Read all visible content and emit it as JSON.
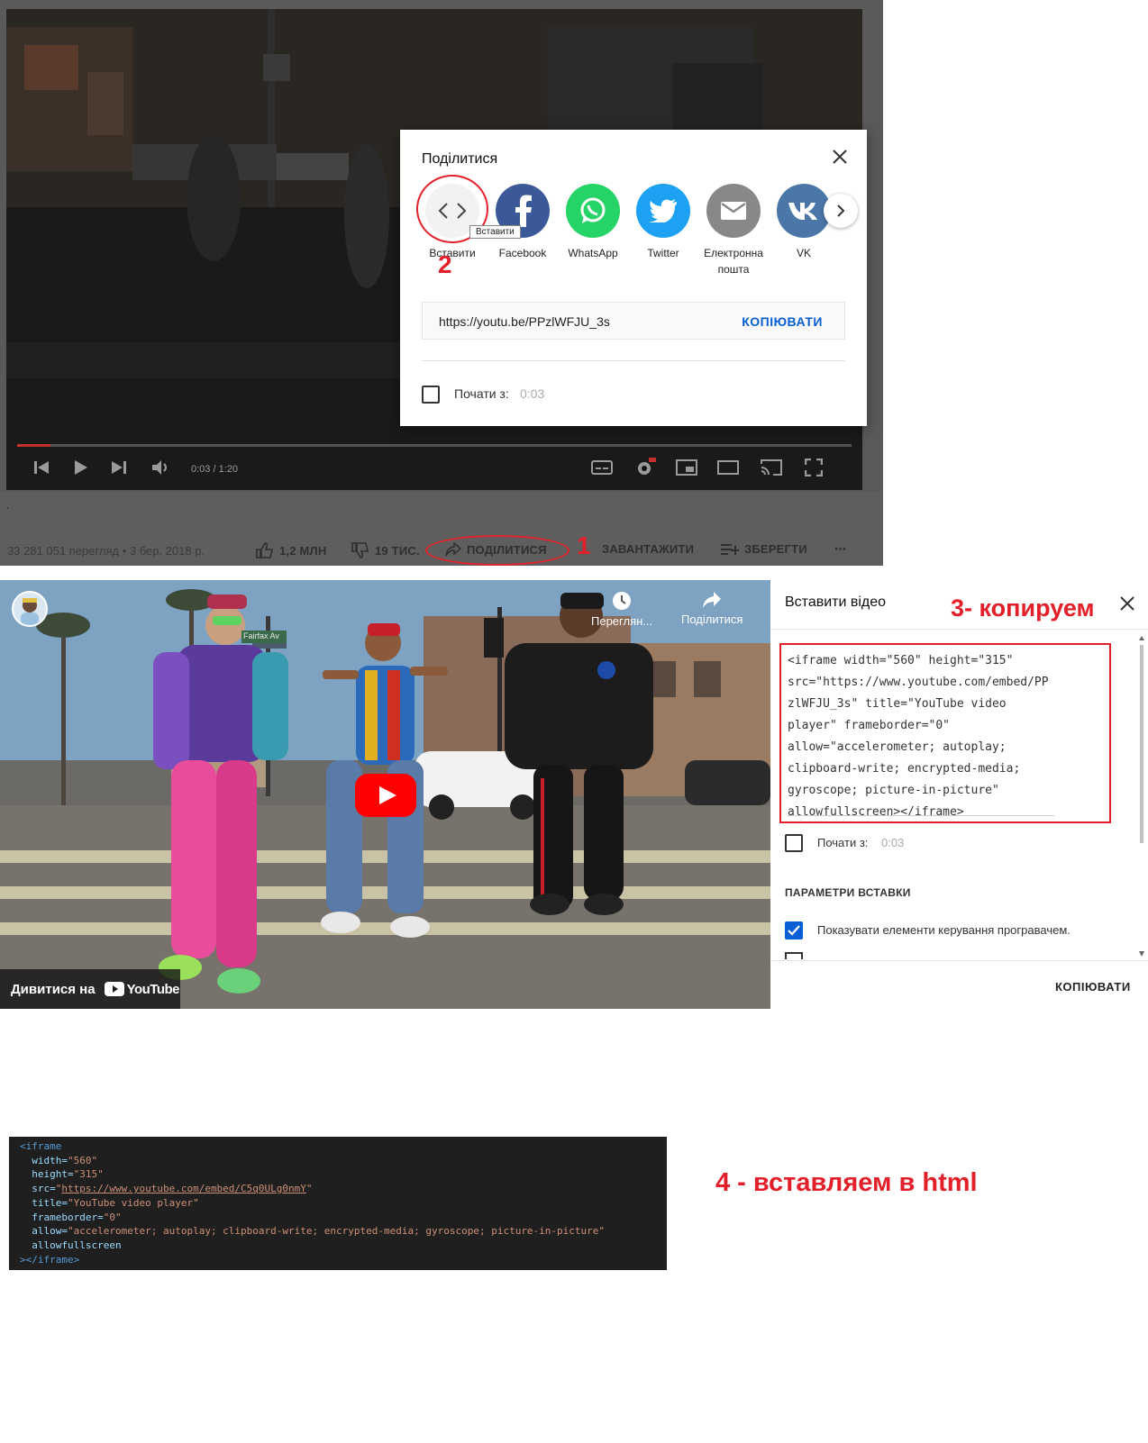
{
  "section1": {
    "player": {
      "time": "0:03 / 1:20",
      "progress_fraction": 0.04
    },
    "meta_dot": ".",
    "views_date": "33 281 051 перегляд • 3 бер. 2018 р.",
    "actions": {
      "like": "1,2 МЛН",
      "dislike": "19 ТИС.",
      "share": "ПОДІЛИТИСЯ",
      "download": "ЗАВАНТАЖИТИ",
      "save": "ЗБЕРЕГТИ",
      "more": "⋯"
    },
    "step1_label": "1",
    "dialog": {
      "title": "Поділитися",
      "services": [
        {
          "label": "Вставити",
          "color": "#f2f2f2",
          "icon": "code-icon"
        },
        {
          "label": "Facebook",
          "color": "#3b5998",
          "icon": "facebook-icon"
        },
        {
          "label": "WhatsApp",
          "color": "#25d366",
          "icon": "whatsapp-icon"
        },
        {
          "label": "Twitter",
          "color": "#1da1f2",
          "icon": "twitter-icon"
        },
        {
          "label": "Електронна пошта",
          "color": "#888888",
          "icon": "email-icon"
        },
        {
          "label": "VK",
          "color": "#4a76a8",
          "icon": "vk-icon"
        }
      ],
      "tooltip": "Вставити",
      "step2_label": "2",
      "url": "https://youtu.be/PPzlWFJU_3s",
      "copy": "КОПІЮВАТИ",
      "start_label": "Почати з:",
      "start_time": "0:03"
    }
  },
  "section2": {
    "player": {
      "watch_later": "Переглян...",
      "share": "Поділитися",
      "watch_on": "Дивитися на",
      "youtube": "YouTube",
      "street_sign": "Fairfax Av"
    },
    "embed": {
      "title": "Вставити відео",
      "step3_label": "3- копируем",
      "code_lines": [
        "<iframe width=\"560\" height=\"315\"",
        "src=\"https://www.youtube.com/embed/PP",
        "zlWFJU_3s\" title=\"YouTube video",
        "player\" frameborder=\"0\"",
        "allow=\"accelerometer; autoplay;",
        "clipboard-write; encrypted-media;",
        "gyroscope; picture-in-picture\"",
        "allowfullscreen></iframe>"
      ],
      "start_label": "Почати з:",
      "start_time": "0:03",
      "params_heading": "ПАРАМЕТРИ ВСТАВКИ",
      "show_controls": "Показувати елементи керування програвачем.",
      "copy": "КОПІЮВАТИ"
    }
  },
  "section3": {
    "code": {
      "open": "<iframe",
      "width_attr": "width=",
      "width_val": "\"560\"",
      "height_attr": "height=",
      "height_val": "\"315\"",
      "src_attr": "src=",
      "src_q1": "\"",
      "src_url": "https://www.youtube.com/embed/C5q0ULg0nmY",
      "src_q2": "\"",
      "title_attr": "title=",
      "title_val": "\"YouTube video player\"",
      "fb_attr": "frameborder=",
      "fb_val": "\"0\"",
      "allow_attr": "allow=",
      "allow_val": "\"accelerometer; autoplay; clipboard-write; encrypted-media; gyroscope; picture-in-picture\"",
      "afs": "allowfullscreen",
      "close": "></iframe>"
    },
    "step4_label": "4 - вставляем в html"
  }
}
